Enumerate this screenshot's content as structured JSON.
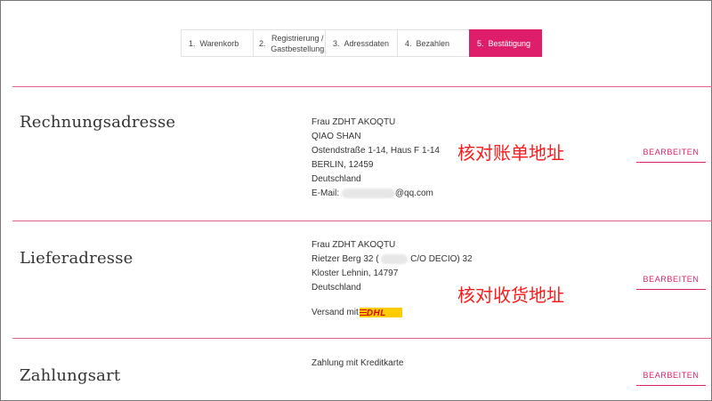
{
  "steps": [
    {
      "num": "1.",
      "label": "Warenkorb"
    },
    {
      "num": "2.",
      "label": "Registrierung / Gastbestellung"
    },
    {
      "num": "3.",
      "label": "Adressdaten"
    },
    {
      "num": "4.",
      "label": "Bezahlen"
    },
    {
      "num": "5.",
      "label": "Bestätigung"
    }
  ],
  "billing": {
    "heading": "Rechnungsadresse",
    "lines": [
      "Frau ZDHT AKOQTU",
      "QIAO SHAN",
      "Ostendstraße 1-14, Haus F 1-14",
      "BERLIN, 12459",
      "Deutschland"
    ],
    "email_label": "E-Mail:",
    "email_suffix": "@qq.com",
    "note": "核对账单地址",
    "edit_label": "BEARBEITEN"
  },
  "shipping": {
    "heading": "Lieferadresse",
    "name": "Frau ZDHT AKOQTU",
    "street_prefix": "Rietzer Berg 32 (",
    "street_suffix": "C/O DECIO) 32",
    "city": "Kloster Lehnin, 14797",
    "country": "Deutschland",
    "shipping_label": "Versand mit",
    "carrier_logo": "DHL",
    "note": "核对收货地址",
    "edit_label": "BEARBEITEN"
  },
  "payment": {
    "heading": "Zahlungsart",
    "method": "Zahlung mit Kreditkarte",
    "edit_label": "BEARBEITEN"
  },
  "colors": {
    "accent": "#de1e6a",
    "note": "#ff1a1a",
    "dhl_yellow": "#ffcc00",
    "dhl_red": "#d40511"
  }
}
